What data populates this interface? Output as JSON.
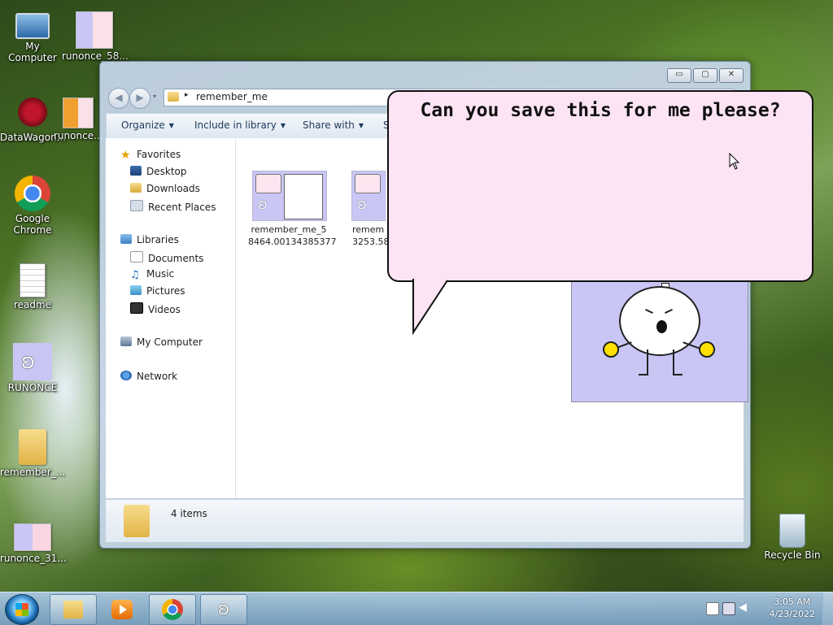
{
  "desktop": {
    "icons": [
      {
        "label": "My Computer"
      },
      {
        "label": "runonce_58..."
      },
      {
        "label": "DataWagon..."
      },
      {
        "label": "runonce..."
      },
      {
        "label": "Google Chrome"
      },
      {
        "label": "readme"
      },
      {
        "label": "RUNONCE"
      },
      {
        "label": "remember_..."
      },
      {
        "label": "runonce_31..."
      },
      {
        "label": "Recycle Bin"
      }
    ]
  },
  "explorer": {
    "address": {
      "path": "remember_me"
    },
    "window_buttons": {
      "minimize": "▭",
      "maximize": "▢",
      "close": "✕"
    },
    "nav_buttons": {
      "back": "◀",
      "forward": "▶",
      "dropdown": "▾",
      "path_arrow": "▸"
    },
    "toolbar": {
      "organize": "Organize",
      "include": "Include in library",
      "share": "Share with",
      "next_partial": "S",
      "caret": "▼"
    },
    "nav_pane": {
      "favorites": "Favorites",
      "favorites_items": [
        "Desktop",
        "Downloads",
        "Recent Places"
      ],
      "libraries": "Libraries",
      "libraries_items": [
        "Documents",
        "Music",
        "Pictures",
        "Videos"
      ],
      "computer": "My Computer",
      "network": "Network"
    },
    "files": [
      {
        "name_line1": "remember_me_5",
        "name_line2": "8464.00134385377"
      },
      {
        "name_line1": "remem",
        "name_line2": "3253.58."
      }
    ],
    "status": {
      "count": "4 items"
    }
  },
  "bubble": {
    "text": "Can you save this for me please?"
  },
  "taskbar": {
    "clock_time": "3:05 AM",
    "clock_date": "4/23/2022"
  },
  "icons": {
    "star": "★",
    "music": "♫",
    "bunny": "🐰"
  },
  "colors": {
    "bubble_fill": "#fde4f4",
    "character_bg": "#c9c6f5",
    "bunny_hands": "#ffe000"
  }
}
